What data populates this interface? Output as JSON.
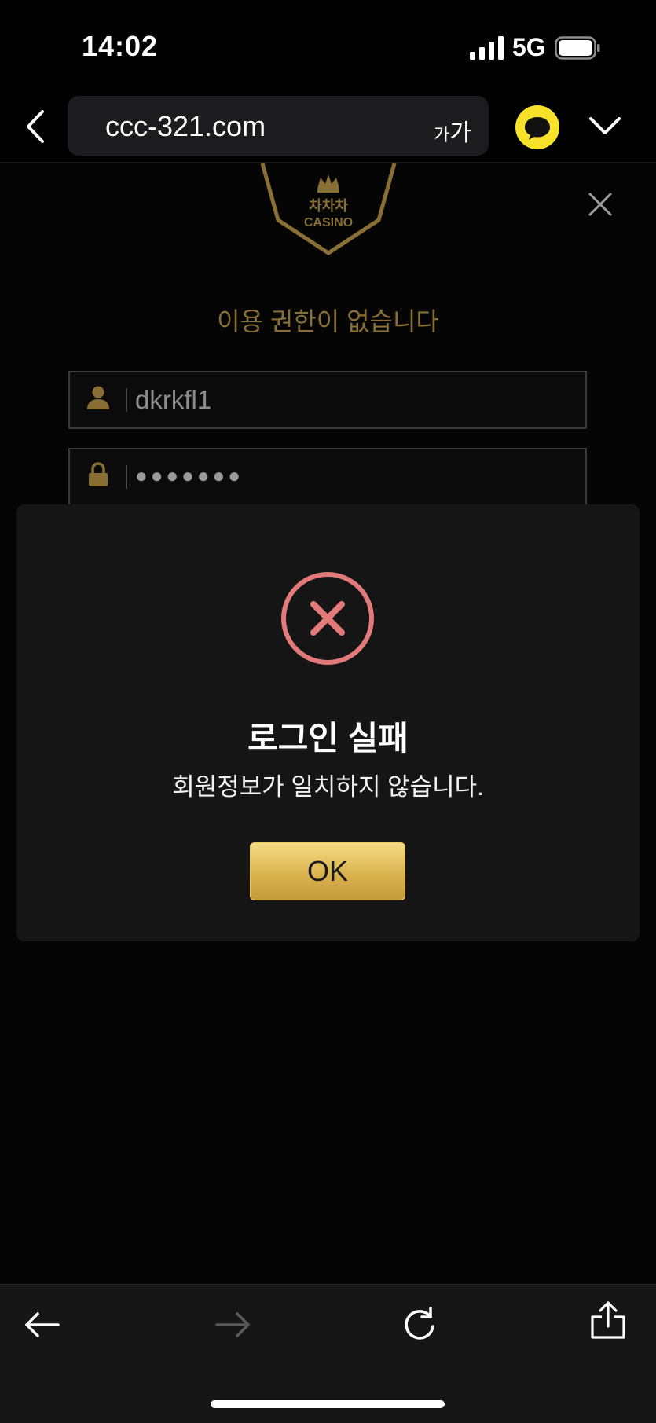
{
  "status_bar": {
    "time": "14:02",
    "network": "5G"
  },
  "browser": {
    "url": "ccc-321.com",
    "text_size_small": "가",
    "text_size_large": "가",
    "accent_color": "#f7e12b"
  },
  "page": {
    "logo": {
      "brand_line1": "차차차",
      "brand_line2": "CASINO",
      "color": "#8a6f35"
    },
    "permission_message": "이용 권한이 없습니다",
    "username_value": "dkrkfl1",
    "password_mask": "●●●●●●●"
  },
  "dialog": {
    "title": "로그인 실패",
    "message": "회원정보가 일치하지 않습니다.",
    "ok_label": "OK",
    "error_color": "#e27a7a",
    "button_color": "#d8b04c"
  },
  "toolbar": {
    "icons": [
      "back-arrow-icon",
      "forward-arrow-icon",
      "reload-icon",
      "share-icon"
    ]
  }
}
